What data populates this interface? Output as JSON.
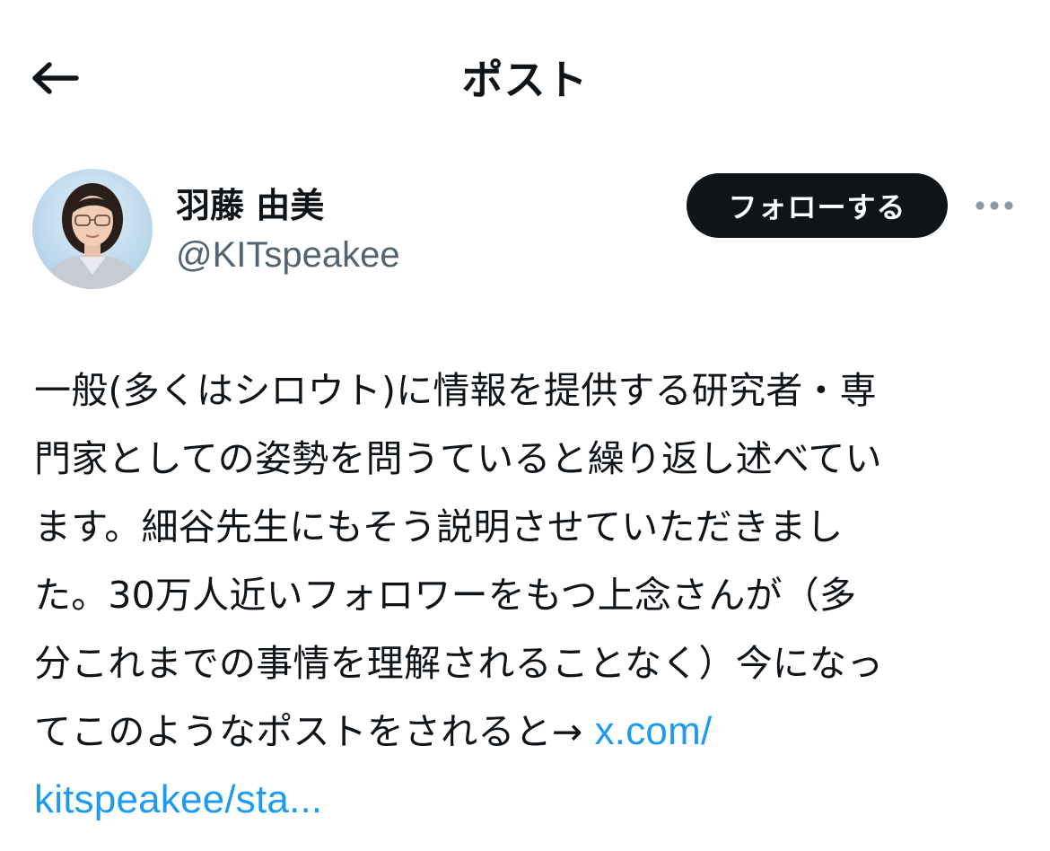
{
  "header": {
    "title": "ポスト",
    "back_icon": "arrow-left-icon"
  },
  "author": {
    "display_name": "羽藤 由美",
    "handle": "@KITspeakee",
    "avatar_icon": "profile-photo"
  },
  "actions": {
    "follow_label": "フォローする",
    "more_icon": "more-horizontal-icon"
  },
  "post": {
    "lines": [
      "一般(多くはシロウト)に情報を提供する研究者・専",
      "門家としての姿勢を問うていると繰り返し述べてい",
      "ます。細谷先生にもそう説明させていただきまし",
      "た。30万人近いフォロワーをもつ上念さんが（多",
      "分これまでの事情を理解されることなく）今になっ",
      "てこのようなポストをされると→ "
    ],
    "link_part1": "x.com/",
    "link_part2": "kitspeakee/sta..."
  },
  "colors": {
    "text": "#0f1419",
    "secondary": "#536471",
    "link": "#1d9bf0",
    "button_bg": "#0f1419"
  }
}
